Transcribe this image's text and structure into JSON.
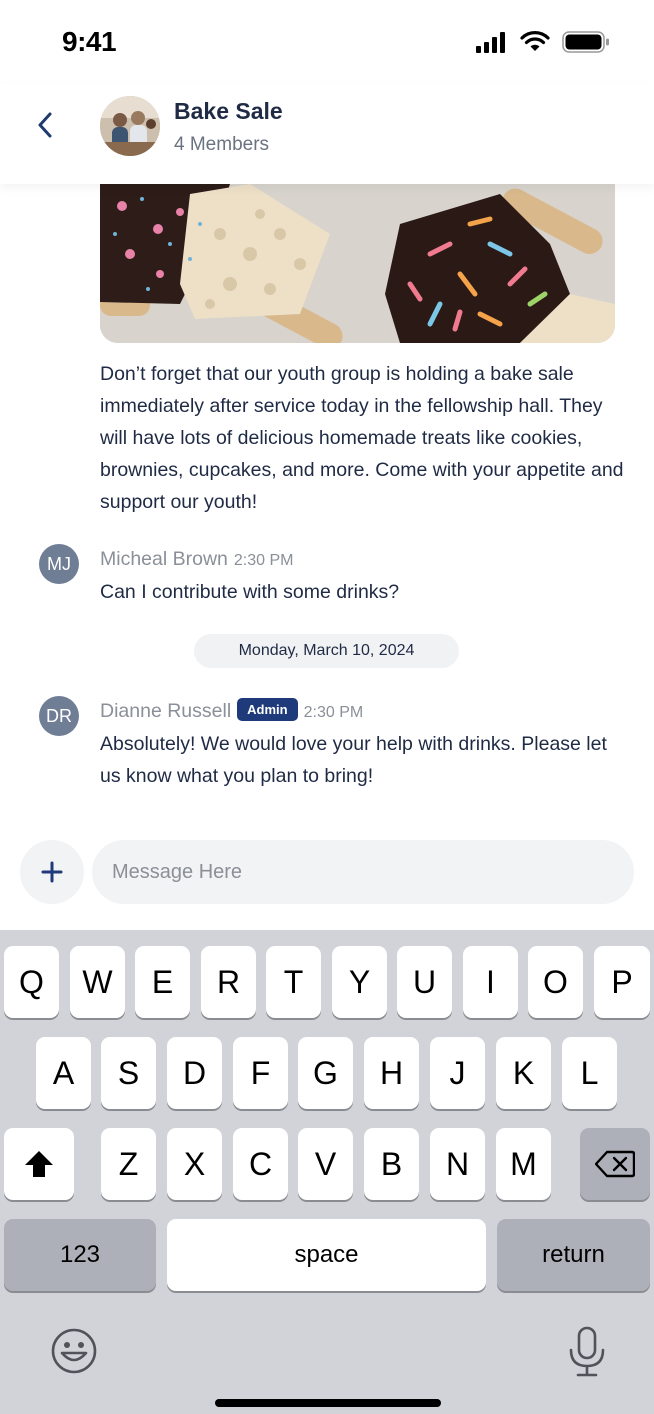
{
  "status_bar": {
    "time": "9:41"
  },
  "header": {
    "title": "Bake Sale",
    "subtitle": "4 Members"
  },
  "post": {
    "text": "Don’t forget that our youth group is holding a bake sale immediately after service today in the fellowship hall. They will have lots of delicious homemade treats like cookies, brownies, cupcakes, and more. Come with your appetite and support our youth!"
  },
  "messages": [
    {
      "initials": "MJ",
      "name": "Micheal Brown",
      "time": "2:30 PM",
      "text": "Can I contribute with some drinks?"
    },
    {
      "initials": "DR",
      "name": "Dianne Russell",
      "badge": "Admin",
      "time": "2:30 PM",
      "text": "Absolutely! We would love your help with drinks. Please let us know what you plan to bring!"
    }
  ],
  "date_separator": "Monday, March 10, 2024",
  "composer": {
    "plus": "+",
    "placeholder": "Message Here"
  },
  "keyboard": {
    "row1": [
      "Q",
      "W",
      "E",
      "R",
      "T",
      "Y",
      "U",
      "I",
      "O",
      "P"
    ],
    "row2": [
      "A",
      "S",
      "D",
      "F",
      "G",
      "H",
      "J",
      "K",
      "L"
    ],
    "row3": [
      "Z",
      "X",
      "C",
      "V",
      "B",
      "N",
      "M"
    ],
    "numbers": "123",
    "space": "space",
    "return": "return"
  },
  "colors": {
    "accent": "#1e3a7a",
    "text": "#1f2a44",
    "muted": "#8a8f98",
    "keyboard_bg": "#d1d3d9"
  }
}
